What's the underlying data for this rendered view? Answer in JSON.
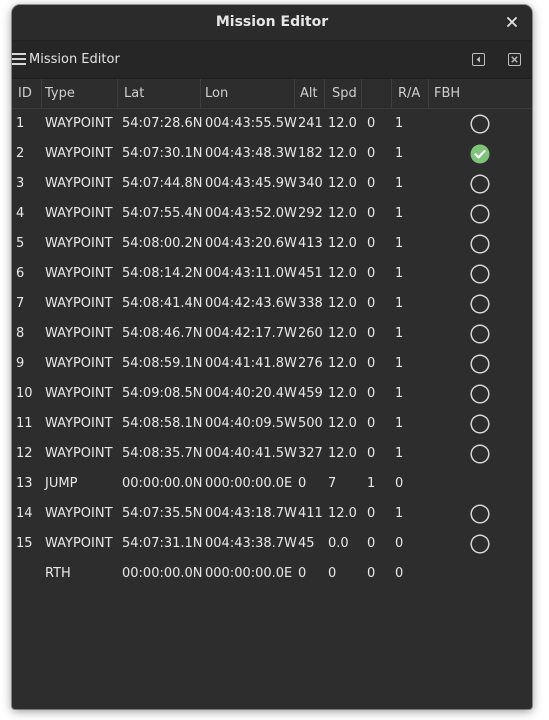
{
  "window": {
    "title": "Mission Editor"
  },
  "toolbar": {
    "title": "Mission Editor"
  },
  "columns": [
    "ID",
    "Type",
    "Lat",
    "Lon",
    "Alt",
    "Spd",
    "",
    "R/A",
    "FBH"
  ],
  "rows": [
    {
      "id": "1",
      "type": "WAYPOINT",
      "lat": "54:07:28.6N",
      "lon": "004:43:55.5W",
      "alt": "241",
      "spd": "12.0",
      "p": "0",
      "ra": "1",
      "fbh": "empty"
    },
    {
      "id": "2",
      "type": "WAYPOINT",
      "lat": "54:07:30.1N",
      "lon": "004:43:48.3W",
      "alt": "182",
      "spd": "12.0",
      "p": "0",
      "ra": "1",
      "fbh": "checked"
    },
    {
      "id": "3",
      "type": "WAYPOINT",
      "lat": "54:07:44.8N",
      "lon": "004:43:45.9W",
      "alt": "340",
      "spd": "12.0",
      "p": "0",
      "ra": "1",
      "fbh": "empty"
    },
    {
      "id": "4",
      "type": "WAYPOINT",
      "lat": "54:07:55.4N",
      "lon": "004:43:52.0W",
      "alt": "292",
      "spd": "12.0",
      "p": "0",
      "ra": "1",
      "fbh": "empty"
    },
    {
      "id": "5",
      "type": "WAYPOINT",
      "lat": "54:08:00.2N",
      "lon": "004:43:20.6W",
      "alt": "413",
      "spd": "12.0",
      "p": "0",
      "ra": "1",
      "fbh": "empty"
    },
    {
      "id": "6",
      "type": "WAYPOINT",
      "lat": "54:08:14.2N",
      "lon": "004:43:11.0W",
      "alt": "451",
      "spd": "12.0",
      "p": "0",
      "ra": "1",
      "fbh": "empty"
    },
    {
      "id": "7",
      "type": "WAYPOINT",
      "lat": "54:08:41.4N",
      "lon": "004:42:43.6W",
      "alt": "338",
      "spd": "12.0",
      "p": "0",
      "ra": "1",
      "fbh": "empty"
    },
    {
      "id": "8",
      "type": "WAYPOINT",
      "lat": "54:08:46.7N",
      "lon": "004:42:17.7W",
      "alt": "260",
      "spd": "12.0",
      "p": "0",
      "ra": "1",
      "fbh": "empty"
    },
    {
      "id": "9",
      "type": "WAYPOINT",
      "lat": "54:08:59.1N",
      "lon": "004:41:41.8W",
      "alt": "276",
      "spd": "12.0",
      "p": "0",
      "ra": "1",
      "fbh": "empty"
    },
    {
      "id": "10",
      "type": "WAYPOINT",
      "lat": "54:09:08.5N",
      "lon": "004:40:20.4W",
      "alt": "459",
      "spd": "12.0",
      "p": "0",
      "ra": "1",
      "fbh": "empty"
    },
    {
      "id": "11",
      "type": "WAYPOINT",
      "lat": "54:08:58.1N",
      "lon": "004:40:09.5W",
      "alt": "500",
      "spd": "12.0",
      "p": "0",
      "ra": "1",
      "fbh": "empty"
    },
    {
      "id": "12",
      "type": "WAYPOINT",
      "lat": "54:08:35.7N",
      "lon": "004:40:41.5W",
      "alt": "327",
      "spd": "12.0",
      "p": "0",
      "ra": "1",
      "fbh": "empty"
    },
    {
      "id": "13",
      "type": "JUMP",
      "lat": "00:00:00.0N",
      "lon": "000:00:00.0E",
      "alt": "0",
      "spd": "7",
      "p": "1",
      "ra": "0",
      "fbh": "none"
    },
    {
      "id": "14",
      "type": "WAYPOINT",
      "lat": "54:07:35.5N",
      "lon": "004:43:18.7W",
      "alt": "411",
      "spd": "12.0",
      "p": "0",
      "ra": "1",
      "fbh": "empty"
    },
    {
      "id": "15",
      "type": "WAYPOINT",
      "lat": "54:07:31.1N",
      "lon": "004:43:38.7W",
      "alt": "45",
      "spd": "0.0",
      "p": "0",
      "ra": "0",
      "fbh": "empty"
    },
    {
      "id": "",
      "type": "RTH",
      "lat": "00:00:00.0N",
      "lon": "000:00:00.0E",
      "alt": "0",
      "spd": "0",
      "p": "0",
      "ra": "0",
      "fbh": "none"
    }
  ],
  "colors": {
    "background": "#2d2d2d",
    "accent_check": "#7fc27a",
    "text": "#e8e8e8"
  },
  "icons": {
    "close": "close-icon",
    "menu": "hamburger-icon",
    "fbh_checked": "check-circle-icon",
    "fbh_empty": "empty-circle-icon"
  }
}
